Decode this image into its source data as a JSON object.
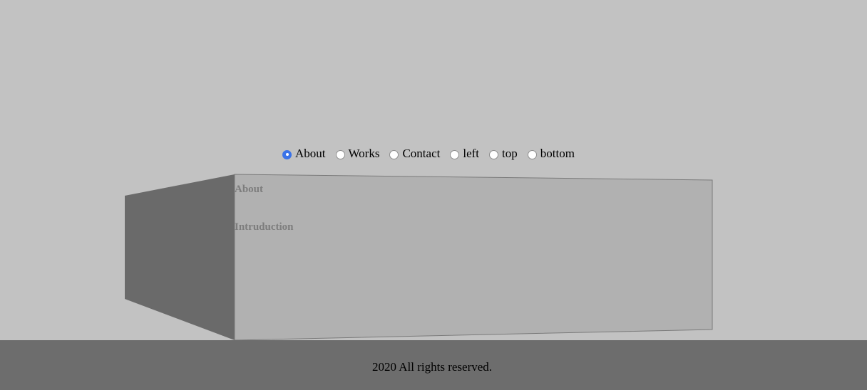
{
  "nav": {
    "items": [
      {
        "label": "About",
        "checked": true
      },
      {
        "label": "Works",
        "checked": false
      },
      {
        "label": "Contact",
        "checked": false
      },
      {
        "label": "left",
        "checked": false
      },
      {
        "label": "top",
        "checked": false
      },
      {
        "label": "bottom",
        "checked": false
      }
    ]
  },
  "panel": {
    "title": "About",
    "subtitle": "Intruduction"
  },
  "footer": {
    "text": "2020 All rights reserved."
  },
  "colors": {
    "background": "#c2c2c2",
    "front_face": "#b1b1b1",
    "side_face": "#6a6a6a",
    "footer": "#6d6d6d",
    "radio_accent": "#3b73e8"
  }
}
